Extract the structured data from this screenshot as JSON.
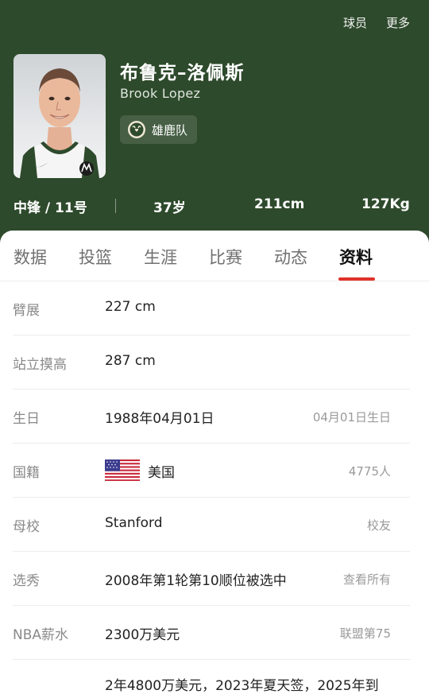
{
  "top_actions": {
    "players": "球员",
    "more": "更多"
  },
  "player": {
    "name_zh": "布鲁克–洛佩斯",
    "name_en": "Brook Lopez",
    "team": "雄鹿队"
  },
  "stats": {
    "position_number": "中锋 / 11号",
    "age": "37岁",
    "height": "211cm",
    "weight": "127Kg"
  },
  "tabs": [
    "数据",
    "投篮",
    "生涯",
    "比赛",
    "动态",
    "资料"
  ],
  "active_tab": "资料",
  "profile": [
    {
      "label": "臂展",
      "value": "227 cm",
      "extra": ""
    },
    {
      "label": "站立摸高",
      "value": "287 cm",
      "extra": ""
    },
    {
      "label": "生日",
      "value": "1988年04月01日",
      "extra": "04月01日生日"
    },
    {
      "label": "国籍",
      "value": "美国",
      "extra": "4775人",
      "icon": "us-flag-icon"
    },
    {
      "label": "母校",
      "value": "Stanford",
      "extra": "校友"
    },
    {
      "label": "选秀",
      "value": "2008年第1轮第10顺位被选中",
      "extra": "查看所有"
    },
    {
      "label": "NBA薪水",
      "value": "2300万美元",
      "extra": "联盟第75"
    }
  ],
  "contract_partial": "2年4800万美元，2023年夏天签，2025年到",
  "colors": {
    "header_green": "#2e4a2c",
    "accent_red": "#e0312a"
  }
}
